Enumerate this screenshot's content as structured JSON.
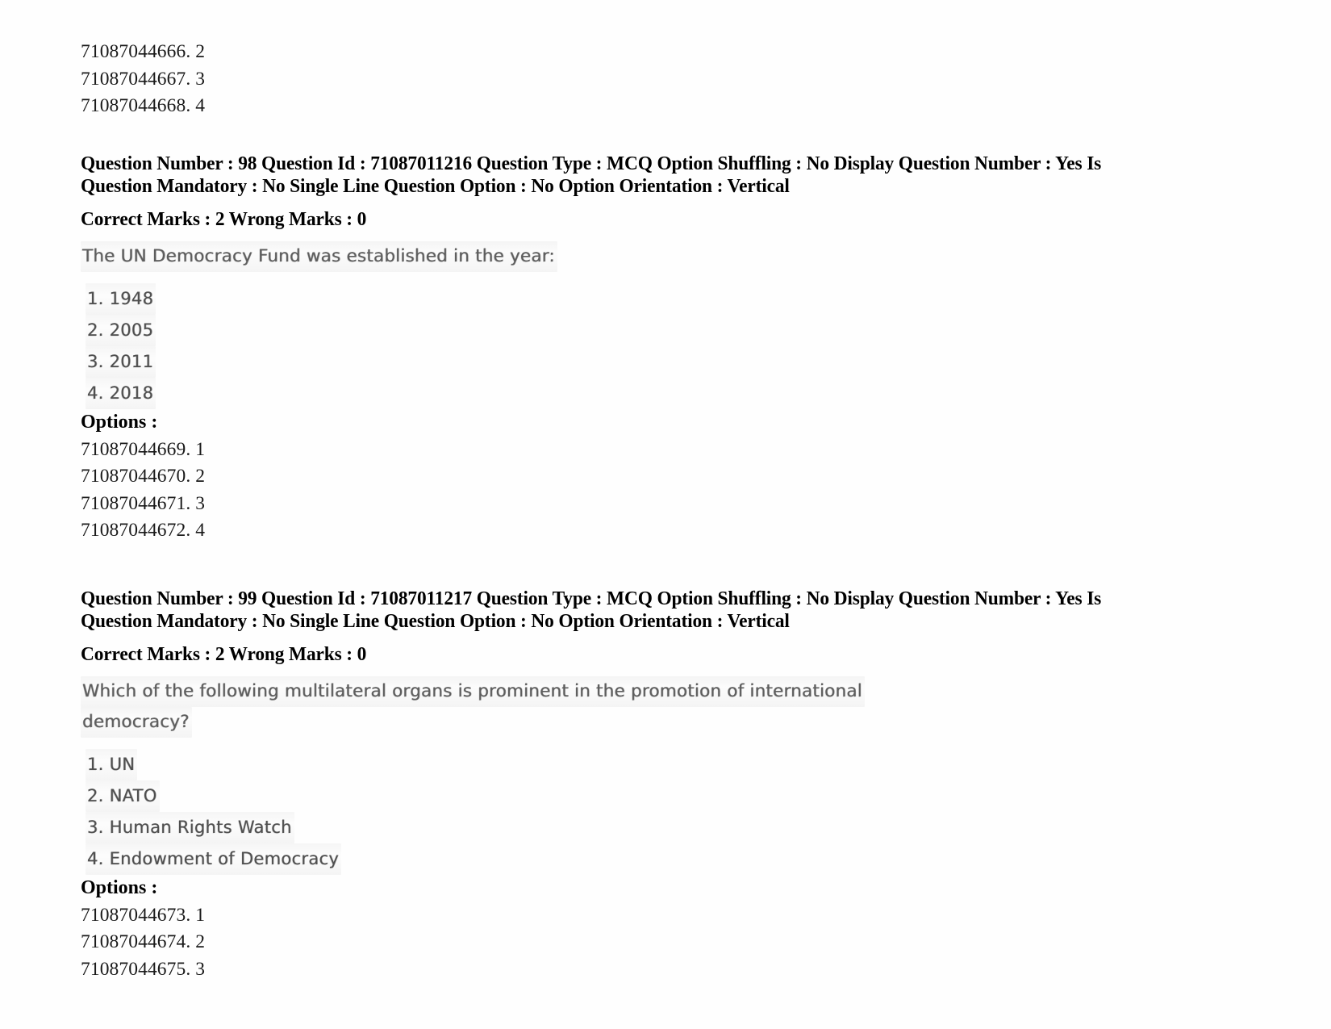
{
  "document": {
    "type": "exam-question-paper",
    "page_background": "#ffffff",
    "text_color": "#000000",
    "scanned_text_color": "#5d5d5d"
  },
  "leading_option_ids": [
    "71087044666. 2",
    "71087044667. 3",
    "71087044668. 4"
  ],
  "questions": [
    {
      "meta_line_1": "Question Number : 98 Question Id : 71087011216 Question Type : MCQ Option Shuffling : No Display Question Number : Yes Is",
      "meta_line_2": "Question Mandatory : No Single Line Question Option : No Option Orientation : Vertical",
      "marks_line": "Correct Marks : 2 Wrong Marks : 0",
      "question_lines": [
        "The UN Democracy Fund was established in the year:"
      ],
      "choices": [
        "1. 1948",
        "2. 2005",
        "3. 2011",
        "4. 2018"
      ],
      "options_label": "Options :",
      "option_ids": [
        "71087044669. 1",
        "71087044670. 2",
        "71087044671. 3",
        "71087044672. 4"
      ]
    },
    {
      "meta_line_1": "Question Number : 99 Question Id : 71087011217 Question Type : MCQ Option Shuffling : No Display Question Number : Yes Is",
      "meta_line_2": "Question Mandatory : No Single Line Question Option : No Option Orientation : Vertical",
      "marks_line": "Correct Marks : 2 Wrong Marks : 0",
      "question_lines": [
        "Which of the following multilateral organs is prominent in the promotion of international",
        "democracy?"
      ],
      "choices": [
        "1. UN",
        "2. NATO",
        "3. Human Rights Watch",
        "4. Endowment of Democracy"
      ],
      "options_label": "Options :",
      "option_ids": [
        "71087044673. 1",
        "71087044674. 2",
        "71087044675. 3"
      ]
    }
  ]
}
